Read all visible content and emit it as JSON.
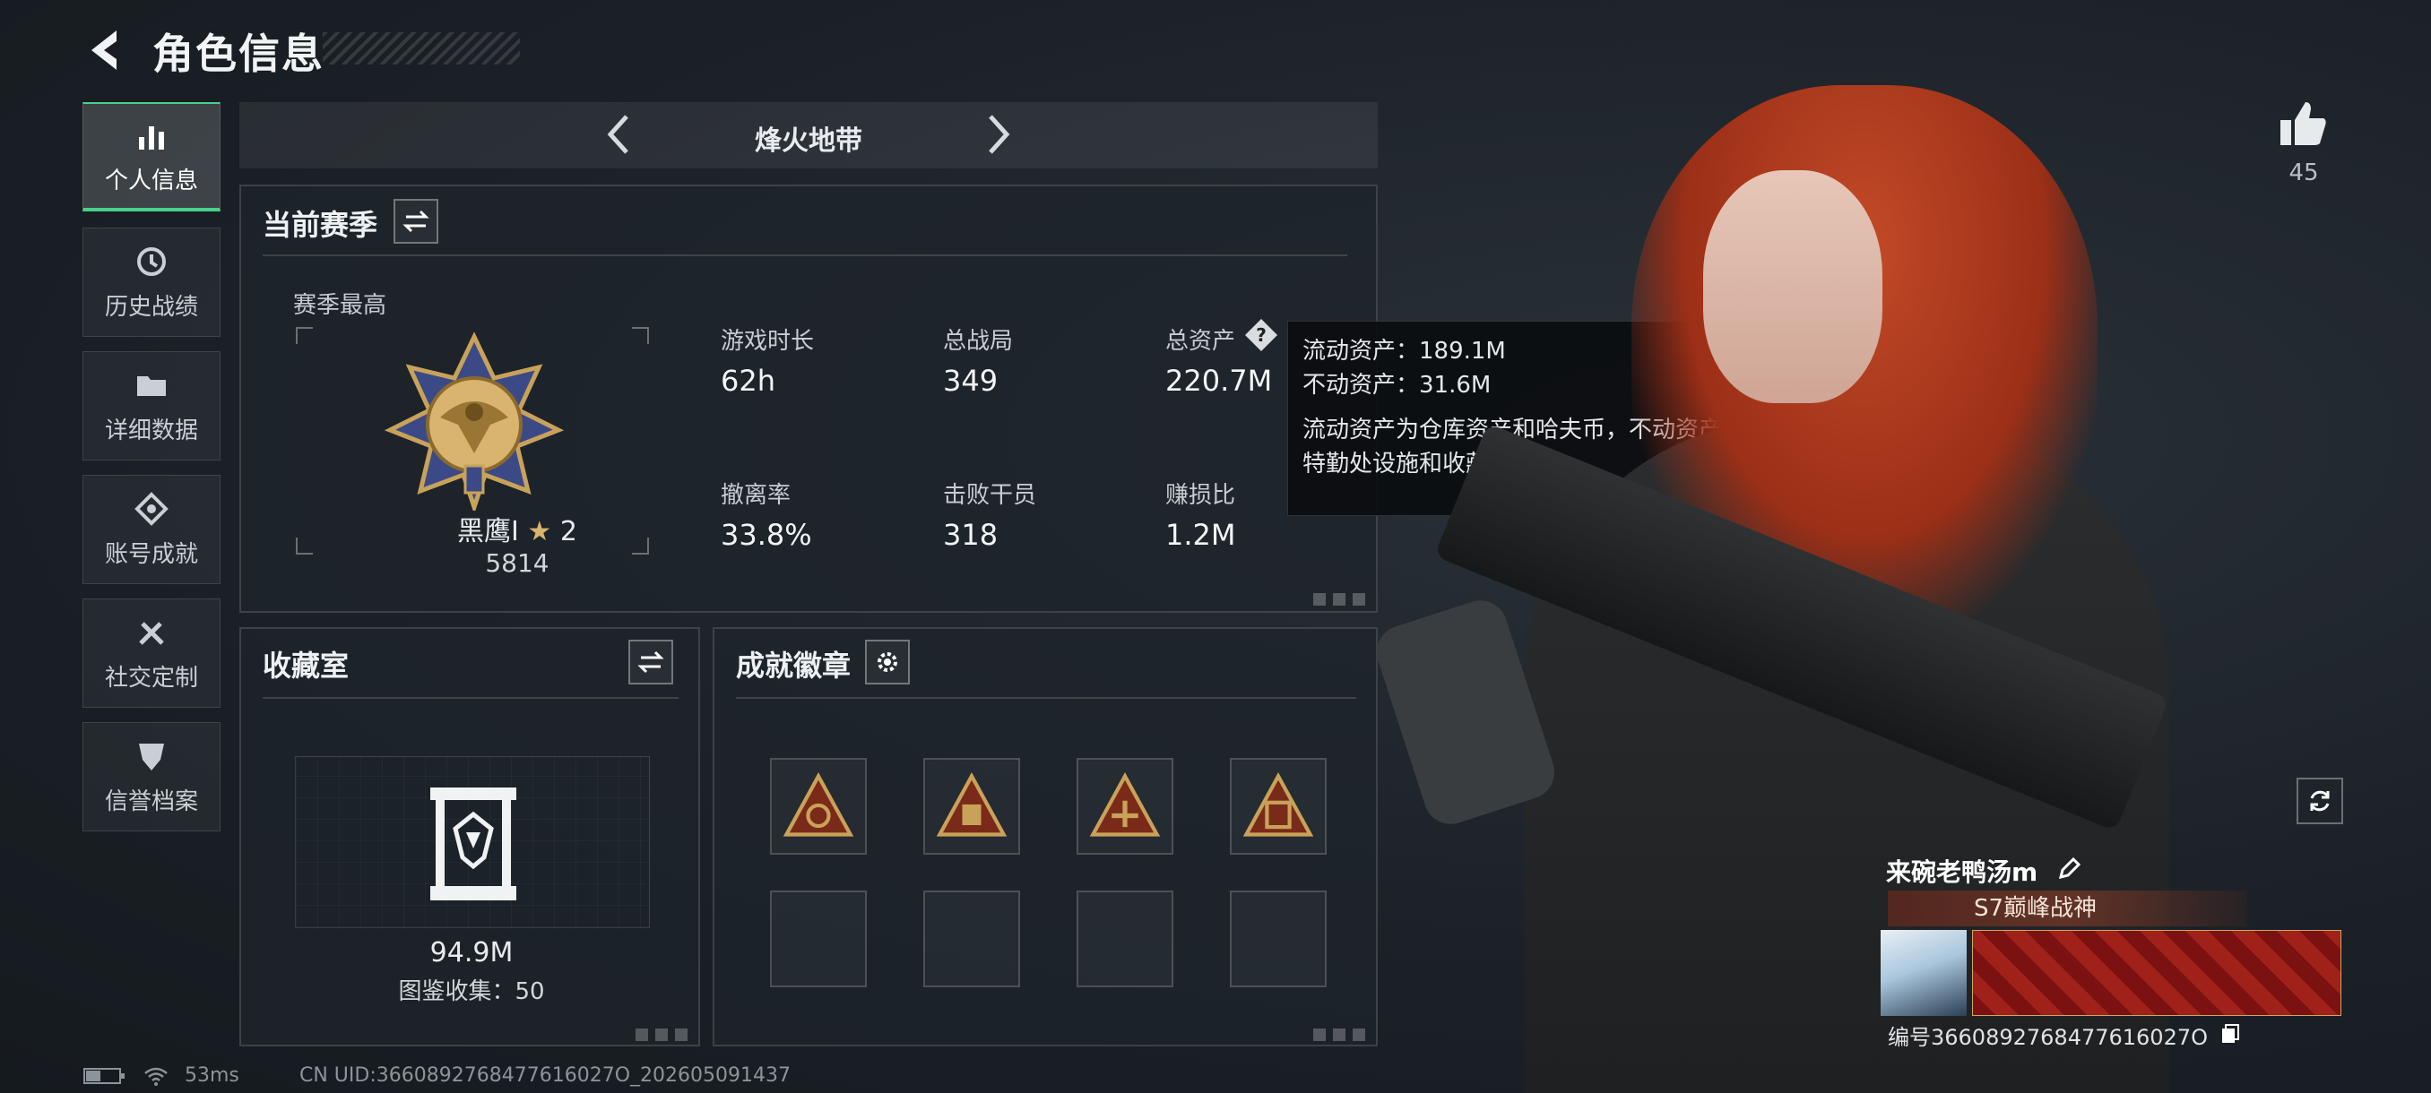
{
  "header": {
    "title": "角色信息"
  },
  "sidebar": {
    "items": [
      {
        "label": "个人信息",
        "icon": "bar-chart-icon",
        "active": true
      },
      {
        "label": "历史战绩",
        "icon": "history-icon"
      },
      {
        "label": "详细数据",
        "icon": "folder-icon"
      },
      {
        "label": "账号成就",
        "icon": "achievement-icon"
      },
      {
        "label": "社交定制",
        "icon": "tools-icon"
      },
      {
        "label": "信誉档案",
        "icon": "shield-icon"
      }
    ]
  },
  "mode": {
    "label": "烽火地带"
  },
  "season": {
    "title": "当前赛季",
    "best_label": "赛季最高",
    "rank_name": "黑鹰Ⅰ",
    "rank_stars": "2",
    "rank_score": "5814",
    "stats": [
      {
        "label": "游戏时长",
        "value": "62h"
      },
      {
        "label": "总战局",
        "value": "349"
      },
      {
        "label": "总资产",
        "value": "220.7M"
      },
      {
        "label": "撤离率",
        "value": "33.8%"
      },
      {
        "label": "击败干员",
        "value": "318"
      },
      {
        "label": "赚损比",
        "value": "1.2M"
      }
    ]
  },
  "tooltip": {
    "line1": "流动资产：189.1M",
    "line2": "不动资产：31.6M",
    "desc": "流动资产为仓库资产和哈夫币，不动资产为特勤处设施和收藏室设施"
  },
  "collection": {
    "title": "收藏室",
    "value": "94.9M",
    "count_text": "图鉴收集：50"
  },
  "badges": {
    "title": "成就徽章"
  },
  "likes": {
    "count": "45"
  },
  "player": {
    "name": "来碗老鸭汤m",
    "title": "S7巅峰战神",
    "uid": "编号3660892768477616027O"
  },
  "status": {
    "latency": "53ms",
    "cn_uid": "CN UID:3660892768477616027O_202605091437"
  },
  "colors": {
    "accent_green": "#49d08c",
    "badge_gold": "#c9a25a"
  }
}
